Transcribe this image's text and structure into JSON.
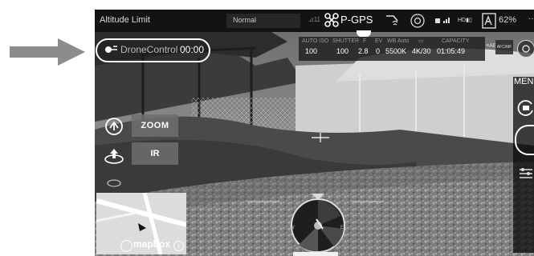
{
  "topbar": {
    "title": "Altitude Limit",
    "flight_mode": "Normal",
    "satellite_count": "11",
    "gps_mode": "P-GPS",
    "transmission": "HD",
    "battery_percent": "62%",
    "more": "···"
  },
  "camera_params": {
    "labels": [
      "AUTO ISO",
      "SHUTTER",
      "F",
      "EV",
      "WB Auto",
      "",
      "CAPACITY"
    ],
    "values": [
      "100",
      "100",
      "2.8",
      "0",
      "5500K",
      "4K/30",
      "01:05:49"
    ],
    "ae": "AE",
    "afc": "AFC/MF"
  },
  "drone_control": {
    "name": "DroneControl",
    "time": "00:00"
  },
  "buttons": {
    "zoom": "ZOOM",
    "ir": "IR"
  },
  "map": {
    "attribution": "mapbox"
  },
  "right_rail": {
    "menu": "MEN"
  },
  "icons": [
    "arrow-right-icon",
    "drone-icon",
    "gps-icon",
    "rc-signal-icon",
    "vision-icon",
    "antenna-icon",
    "battery-icon",
    "settings-icon",
    "takeoff-icon",
    "return-home-icon",
    "camera-switch-icon",
    "shutter-icon",
    "playback-icon",
    "compass-icon",
    "mapbox-logo-icon",
    "info-icon"
  ]
}
